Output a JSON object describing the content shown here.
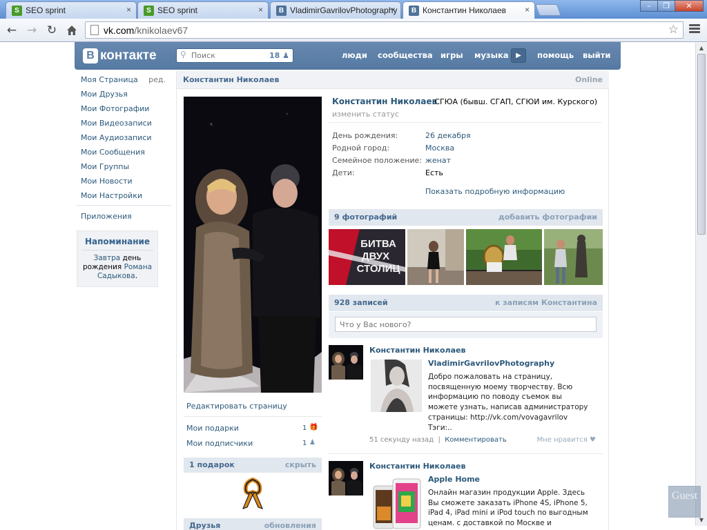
{
  "browser": {
    "tabs": [
      {
        "title": "SEO sprint",
        "favicon": "S",
        "active": false
      },
      {
        "title": "SEO sprint",
        "favicon": "S",
        "active": false
      },
      {
        "title": "VladimirGavrilovPhotography",
        "favicon": "B",
        "active": false
      },
      {
        "title": "Константин Николаев",
        "favicon": "B",
        "active": true
      }
    ],
    "url_host": "vk.com",
    "url_path": "/knikolaev67",
    "tab_close_glyph": "×",
    "window_buttons": {
      "minimize": "–",
      "maximize": "❐",
      "close": "✕"
    }
  },
  "vk": {
    "logo_letter": "B",
    "logo_text": "контакте",
    "search_placeholder": "Поиск",
    "search_count": "18",
    "nav": [
      "люди",
      "сообщества",
      "игры",
      "музыка",
      "помощь",
      "выйти"
    ],
    "menu": [
      "Моя Страница",
      "Мои Друзья",
      "Мои Фотографии",
      "Мои Видеозаписи",
      "Мои Аудиозаписи",
      "Мои Сообщения",
      "Мои Группы",
      "Мои Новости",
      "Мои Настройки"
    ],
    "menu_edit": "ред.",
    "apps": "Приложения",
    "reminder": {
      "title": "Напоминание",
      "tomorrow": "Завтра",
      "text_mid": " день рождения ",
      "name": "Романа Садыкова",
      "end": "."
    }
  },
  "profile": {
    "bar_name": "Константин Николаев",
    "online": "Online",
    "name": "Константин Николаев",
    "university": "СГЮА (бывш. СГАП, СГЮИ им. Курского)",
    "change_status": "изменить статус",
    "info": [
      {
        "label": "День рождения:",
        "value": "26 декабря",
        "link": true
      },
      {
        "label": "Родной город:",
        "value": "Москва",
        "link": true
      },
      {
        "label": "Семейное положение:",
        "value": "женат",
        "link": true
      },
      {
        "label": "Дети:",
        "value": "Есть",
        "link": false
      }
    ],
    "show_more": "Показать подробную информацию",
    "edit_page": "Редактировать страницу",
    "gifts_label": "Мои подарки",
    "gifts_count": "1",
    "subs_label": "Мои подписчики",
    "subs_count": "1",
    "gift_block": {
      "title": "1 подарок",
      "hide": "скрыть"
    },
    "friends_block": {
      "title": "Друзья",
      "updates": "обновления"
    },
    "photos_block": {
      "title": "9 фотографий",
      "add": "добавить фотографии"
    },
    "photo1_caption": [
      "БИТВА",
      "ДВУХ",
      "СТОЛИЦ"
    ],
    "wall_block": {
      "title": "928 записей",
      "link": "к записям Константина"
    },
    "wall_placeholder": "Что у Вас нового?"
  },
  "posts": [
    {
      "author": "Константин Николаев",
      "title": "VladimirGavrilovPhotography",
      "text": "Добро пожаловать на страницу, посвященную моему творчеству. Всю информацию по поводу съемок вы можете узнать, написав администратору страницы: http://vk.com/vovagavrilov Тэги:..",
      "time": "51 секунду назад",
      "comment": "Комментировать",
      "like": "Мне нравится"
    },
    {
      "author": "Константин Николаев",
      "title": "Apple Home",
      "text": "Онлайн магазин продукции Apple. Здесь Вы сможете заказать iPhone 4S, iPhone 5, iPad 4, iPad mini и iPod touch по выгодным ценам. с доставкой по Москве и гарантией"
    }
  ],
  "overlay_badge": "Guest",
  "colors": {
    "vk_blue": "#5b7fa6",
    "link": "#2b587a",
    "bar": "#e1e7ee"
  }
}
